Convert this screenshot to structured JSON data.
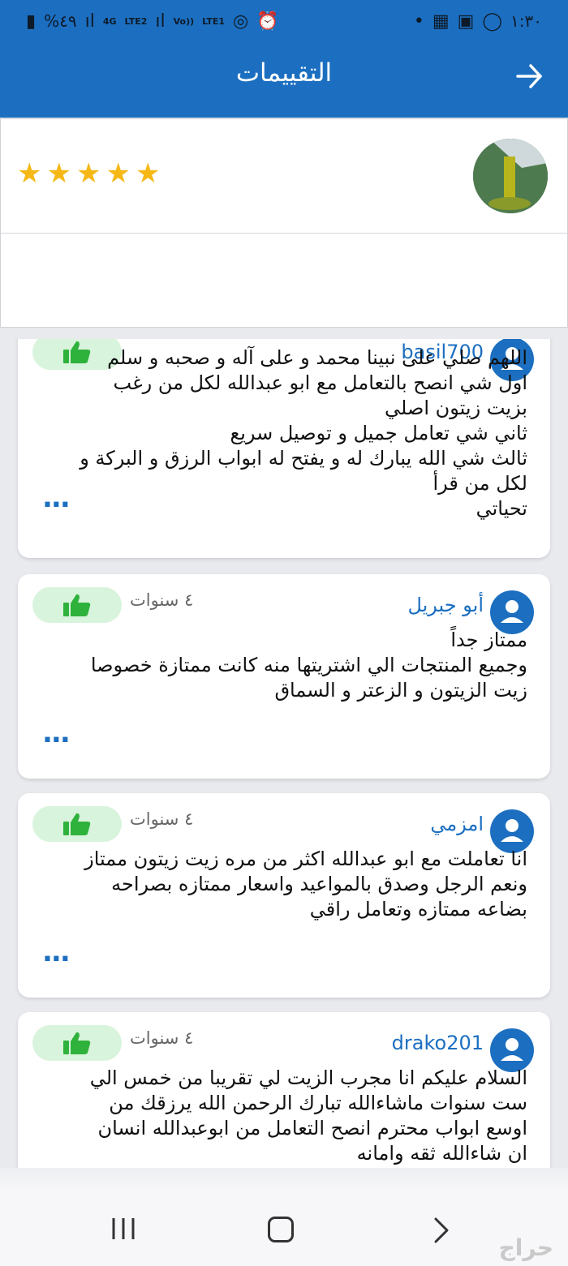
{
  "status_bar": {
    "battery_percent": "%٤٩",
    "network_1": "4G",
    "lte_1": "LTE2",
    "network_2": "Vo))",
    "lte_2": "LTE1",
    "time": "١:٣٠"
  },
  "header": {
    "title": "التقييمات"
  },
  "summary": {
    "rating": 5,
    "max_rating": 5
  },
  "reviews": [
    {
      "name": "basil700",
      "age": "",
      "text": "اللهم صلي على نبينا محمد و على آله و صحبه و سلم\nاول شي انصح بالتعامل مع ابو عبدالله لكل من رغب\nبزيت زيتون اصلي\nثاني شي تعامل جميل و توصيل سريع\nثالث شي الله يبارك له و يفتح له ابواب الرزق و البركة و\nلكل من قرأ\nتحياتي",
      "more": "..."
    },
    {
      "name": "أبو جبريل",
      "age": "٤ سنوات",
      "text": "ممتاز جداً\nوجميع المنتجات الي اشتريتها منه كانت ممتازة  خصوصا\nزيت الزيتون و الزعتر و السماق",
      "more": "..."
    },
    {
      "name": "امزمي",
      "age": "٤ سنوات",
      "text": "انا تعاملت مع ابو عبدالله اكثر من مره زيت زيتون ممتاز\nونعم الرجل وصدق بالمواعيد واسعار ممتازه بصراحه\nبضاعه ممتازه وتعامل راقي",
      "more": "..."
    },
    {
      "name": "drako201",
      "age": "٤ سنوات",
      "text": "السلام عليكم انا مجرب الزيت لي تقريبا من خمس الي\nست سنوات ماشاءالله تبارك الرحمن الله يرزقك من\nاوسع ابواب محترم انصح التعامل من ابوعبدالله انسان\nان شاءالله ثقه وامانه",
      "more": ""
    }
  ],
  "watermark": "حراج",
  "colors": {
    "primary": "#1c6fc0",
    "star": "#f6b817",
    "like_bg": "#d8f4dc",
    "like_icon": "#2fb23c"
  },
  "icons": {
    "back": "arrow-right-icon",
    "avatar": "person-icon",
    "like": "thumbs-up-icon"
  }
}
